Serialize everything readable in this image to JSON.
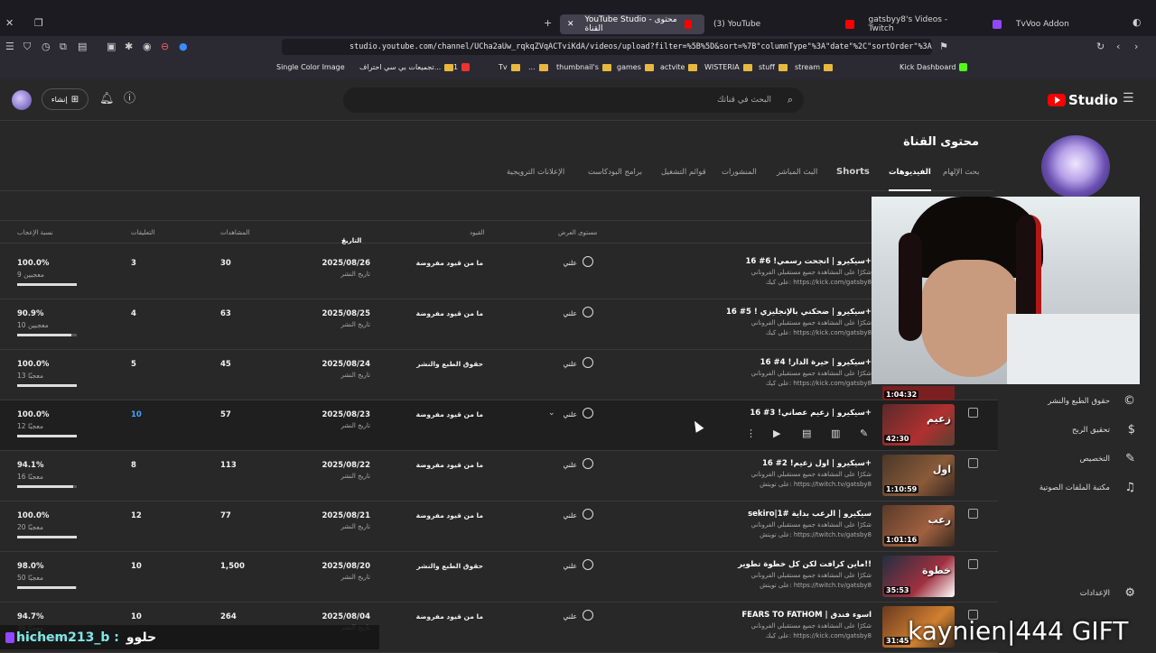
{
  "browser": {
    "tabs": [
      {
        "label": "YouTube Studio - محتوى القناة",
        "active": true
      },
      {
        "label": "(3) YouTube",
        "active": false
      },
      {
        "label": "gatsbyy8's Videos - Twitch",
        "active": false
      },
      {
        "label": "TvVoo Addon",
        "active": false
      }
    ],
    "url": "studio.youtube.com/channel/UCha2aUw_rqkqZVqACTviKdA/videos/upload?filter=%5B%5D&sort=%7B\"columnType\"%3A\"date\"%2C\"sortOrder\"%3A\"...",
    "bookmarks": [
      "Single Color Image",
      "تجميعات بي سي احتراف...",
      "1",
      "Tv",
      "...",
      "thumbnail's",
      "games",
      "actvite",
      "WISTERIA",
      "stuff",
      "stream",
      "Kick Dashboard"
    ]
  },
  "studio": {
    "logo_text": "Studio",
    "search_placeholder": "البحث في قناتك",
    "create_label": "إنشاء",
    "page_title": "محتوى القناة",
    "content_tabs": [
      "بحث الإلهام",
      "الفيديوهات",
      "Shorts",
      "البث المباشر",
      "المنشورات",
      "قوائم التشغيل",
      "برامج البودكاست",
      "الإعلانات الترويجية"
    ],
    "active_tab": "الفيديوهات",
    "columns": {
      "visibility": "مستوى العرض",
      "restrictions": "القيود",
      "date": "التاريخ",
      "views": "المشاهدات",
      "comments": "التعليقات",
      "like_ratio": "نسبة الإعجاب"
    },
    "rows": [
      {
        "title": "سيكيرو | انجحت رسمي! 6# 16+",
        "desc1": "شكرًا على المشاهدة جميع مستقبلي الفروناني",
        "desc2": "على كيك: https://kick.com/gatsby8",
        "duration": "",
        "thumb_text": "",
        "visibility": "علني",
        "restriction": "ما من قيود مفروضة",
        "date": "2025/08/26",
        "date_sub": "تاريخ النشر",
        "views": "30",
        "comments": "3",
        "ratio": "100.0%",
        "ratio_sub": "9 معجبين",
        "ratio_pct": 100
      },
      {
        "title": "سيكيرو | ضحكني بالإنجليزي ! 5# 16+",
        "desc1": "شكرًا على المشاهدة جميع مستقبلي الفروناني",
        "desc2": "على كيك: https://kick.com/gatsby8",
        "duration": "",
        "thumb_text": "",
        "visibility": "علني",
        "restriction": "ما من قيود مفروضة",
        "date": "2025/08/25",
        "date_sub": "تاريخ النشر",
        "views": "63",
        "comments": "4",
        "ratio": "90.9%",
        "ratio_sub": "10 معجبين",
        "ratio_pct": 90.9
      },
      {
        "title": "سيكيرو | حيرة الدار! 4# 16+",
        "desc1": "شكرًا على المشاهدة جميع مستقبلي الفروناني",
        "desc2": "على كيك: https://kick.com/gatsby8",
        "duration": "1:04:32",
        "thumb_text": "",
        "visibility": "علني",
        "restriction": "حقوق الطبع والنشر",
        "date": "2025/08/24",
        "date_sub": "تاريخ النشر",
        "views": "45",
        "comments": "5",
        "ratio": "100.0%",
        "ratio_sub": "13 معجبًا",
        "ratio_pct": 100
      },
      {
        "title": "سيكيرو | زعيم عصاني! 3# 16+",
        "desc1": "",
        "desc2": "",
        "duration": "42:30",
        "thumb_text": "زعيم",
        "visibility": "علني",
        "restriction": "ما من قيود مفروضة",
        "date": "2025/08/23",
        "date_sub": "تاريخ النشر",
        "views": "57",
        "comments": "10",
        "ratio": "100.0%",
        "ratio_sub": "12 معجبًا",
        "ratio_pct": 100
      },
      {
        "title": "سيكيرو | اول زعيم! 2# 16+",
        "desc1": "شكرًا على المشاهدة جميع مستقبلي الفروناني",
        "desc2": "على تويتش: https://twitch.tv/gatsby8",
        "duration": "1:10:59",
        "thumb_text": "اول",
        "visibility": "علني",
        "restriction": "ما من قيود مفروضة",
        "date": "2025/08/22",
        "date_sub": "تاريخ النشر",
        "views": "113",
        "comments": "8",
        "ratio": "94.1%",
        "ratio_sub": "16 معجبًا",
        "ratio_pct": 94.1
      },
      {
        "title": "sekiro|1# سيكيرو | الرعب بداية",
        "desc1": "شكرًا على المشاهدة جميع مستقبلي الفروناني",
        "desc2": "على تويتش: https://twitch.tv/gatsby8",
        "duration": "1:01:16",
        "thumb_text": "رعب",
        "visibility": "علني",
        "restriction": "ما من قيود مفروضة",
        "date": "2025/08/21",
        "date_sub": "تاريخ النشر",
        "views": "77",
        "comments": "12",
        "ratio": "100.0%",
        "ratio_sub": "20 معجبًا",
        "ratio_pct": 100
      },
      {
        "title": "ماين كرافت لكن كل خطوة تطوير!!",
        "desc1": "شكرًا على المشاهدة جميع مستقبلي الفروناني",
        "desc2": "على تويتش: https://twitch.tv/gatsby8",
        "duration": "35:53",
        "thumb_text": "خطوة",
        "visibility": "علني",
        "restriction": "حقوق الطبع والنشر",
        "date": "2025/08/20",
        "date_sub": "تاريخ النشر",
        "views": "1,500",
        "comments": "10",
        "ratio": "98.0%",
        "ratio_sub": "50 معجبًا",
        "ratio_pct": 98
      },
      {
        "title": "FEARS TO FATHOM | اسوء فندق",
        "desc1": "شكرًا على المشاهدة جميع مستقبلي الفروناني",
        "desc2": "على كيك: https://kick.com/gatsby8",
        "duration": "31:45",
        "thumb_text": "",
        "visibility": "علني",
        "restriction": "ما من قيود مفروضة",
        "date": "2025/08/04",
        "date_sub": "تاريخ النشر",
        "views": "264",
        "comments": "10",
        "ratio": "94.7%",
        "ratio_sub": "36 معجبًا",
        "ratio_pct": 94.7
      }
    ],
    "sidebar": [
      {
        "label": "حقوق الطبع والنشر",
        "icon": "copyright-icon"
      },
      {
        "label": "تحقيق الربح",
        "icon": "dollar-icon"
      },
      {
        "label": "التخصيص",
        "icon": "magic-wand-icon"
      },
      {
        "label": "مكتبة الملفات الصوتية",
        "icon": "audio-library-icon"
      },
      {
        "label": "الإعدادات",
        "icon": "gear-icon"
      }
    ]
  },
  "overlays": {
    "chat_user": "hichem213_b :",
    "chat_msg": "حلوو",
    "gift_text": "kaynien|444 GIFT"
  },
  "colors": {
    "accent": "#3ea6ff",
    "brand": "#ff0000",
    "bg": "#282828"
  }
}
